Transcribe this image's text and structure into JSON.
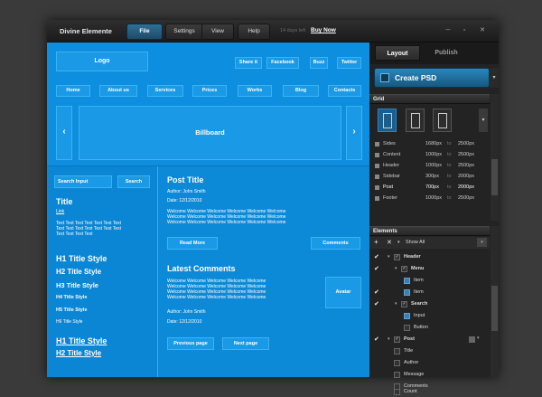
{
  "app": {
    "title": "Divine Elemente",
    "tabs": [
      {
        "label": "File",
        "active": true
      },
      {
        "label": "Settings",
        "active": false
      },
      {
        "label": "View",
        "active": false
      },
      {
        "label": "Help",
        "active": false
      }
    ],
    "trial_text": "14 days left",
    "buy_now": "Buy Now",
    "window_controls": [
      "minimize-icon",
      "restore-icon",
      "close-icon"
    ]
  },
  "canvas": {
    "logo": "Logo",
    "social": [
      "Share it",
      "Facebook",
      "Buzz",
      "Twitter"
    ],
    "nav": [
      "Home",
      "About us",
      "Services",
      "Prices",
      "Works",
      "Blog",
      "Contacts"
    ],
    "billboard": "Billboard",
    "prev_arrow": "‹",
    "next_arrow": "›",
    "sidebar": {
      "search_placeholder": "Search Input",
      "search_button": "Search",
      "title": "Title",
      "link": "Link",
      "text_lines": [
        "Text Text Text Text Text Text Text",
        "Text Text Text Text Text Text Text",
        "Text Text Text Text"
      ],
      "h1": "H1 Title Style",
      "h2": "H2 Title Style",
      "h3": "H3 Title Style",
      "h4": "H4 Title Style",
      "h5": "H5 Title Style",
      "h6": "H6 Title Style",
      "h1_link": "H1 Title Style",
      "h2_link": "H2 Title Style"
    },
    "main": {
      "post_title": "Post Title",
      "author": "Author: John Smith",
      "date": "Date: 12/12/2010",
      "post_lines": [
        "Welcome Welcome Welcome Welcome Welcome Welcome",
        "Welcome Welcome Welcome Welcome Welcome Welcome",
        "Welcome Welcome Welcome Welcome Welcome Welcome"
      ],
      "read_more": "Read More",
      "comments_button": "Comments",
      "latest_comments": "Latest Comments",
      "comment_lines": [
        "Welcome Welcome Welcome Welcome Welcome",
        "Welcome Welcome Welcome Welcome Welcome",
        "Welcome Welcome Welcome Welcome Welcome",
        "Welcome Welcome Welcome Welcome Welcome"
      ],
      "avatar": "Avatar",
      "comment_author": "Author: John Smith",
      "comment_date": "Date: 12/12/2010",
      "prev_page": "Previous page",
      "next_page": "Next page"
    }
  },
  "panel": {
    "tabs": [
      {
        "label": "Layout",
        "active": true
      },
      {
        "label": "Publish",
        "active": false
      }
    ],
    "create_psd": "Create PSD",
    "grid_title": "Grid",
    "grid_rows": [
      {
        "label": "Sides",
        "min": "1680px",
        "max": "2500px"
      },
      {
        "label": "Content",
        "min": "1000px",
        "max": "2500px"
      },
      {
        "label": "Header",
        "min": "1000px",
        "max": "2500px"
      },
      {
        "label": "Sidebar",
        "min": "300px",
        "max": "2000px"
      },
      {
        "label": "Post",
        "min": "700px",
        "max": "2000px"
      },
      {
        "label": "Footer",
        "min": "1000px",
        "max": "2500px"
      }
    ],
    "to_label": "to",
    "elements_title": "Elements",
    "show_all": "Show All",
    "elements": [
      {
        "label": "Header"
      },
      {
        "label": "Menu"
      },
      {
        "label": "Item"
      },
      {
        "label": "Item"
      },
      {
        "label": "Search"
      },
      {
        "label": "Input"
      },
      {
        "label": "Button"
      },
      {
        "label": "Post"
      },
      {
        "label": "Title"
      },
      {
        "label": "Author"
      },
      {
        "label": "Message"
      },
      {
        "label": "Comments"
      },
      {
        "label": "Count"
      }
    ]
  },
  "colors": {
    "accent": "#0b8ad8",
    "panel_bg": "#232323",
    "active_tab": "#2f6f96"
  }
}
